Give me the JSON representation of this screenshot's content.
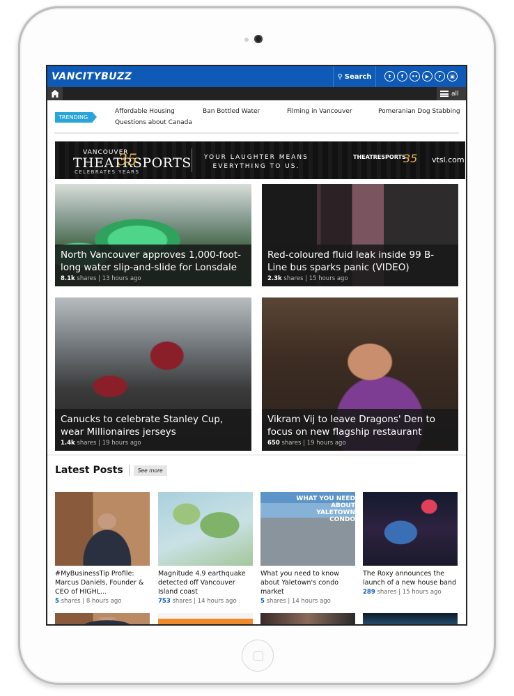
{
  "site": {
    "logo_text": "VANCITYBUZZ",
    "search_label": "Search",
    "social_icons": [
      "twitter-icon",
      "facebook-icon",
      "flickr-icon",
      "youtube-icon",
      "reddit-icon",
      "instagram-icon"
    ],
    "menu_label": "all",
    "brand_color": "#0e5ab6"
  },
  "trending": {
    "label": "TRENDING",
    "links": [
      "Affordable Housing",
      "Ban Bottled Water",
      "Filming in Vancouver",
      "Pomeranian Dog Stabbing",
      "Questions about Canada"
    ]
  },
  "ad": {
    "line1": "VANCOUVER",
    "line2": "THEATRSPORTS",
    "number": "35",
    "line3": "CELEBRATES YEARS",
    "tagline1": "YOUR LAUGHTER MEANS",
    "tagline2": "EVERYTHING TO US.",
    "logo_text": "THEATRESPORTS",
    "number2": "35",
    "url": "vtsl.com"
  },
  "featured": [
    {
      "title": "North Vancouver approves 1,000-foot-long water slip-and-slide for Lonsdale",
      "shares": "8.1k",
      "shares_label": "shares",
      "time": "13 hours ago"
    },
    {
      "title": "Red-coloured fluid leak inside 99 B-Line bus sparks panic (VIDEO)",
      "shares": "2.3k",
      "shares_label": "shares",
      "time": "15 hours ago"
    },
    {
      "title": "Canucks to celebrate Stanley Cup, wear Millionaires jerseys",
      "shares": "1.4k",
      "shares_label": "shares",
      "time": "19 hours ago"
    },
    {
      "title": "Vikram Vij to leave Dragons' Den to focus on new flagship restaurant",
      "shares": "650",
      "shares_label": "shares",
      "time": "19 hours ago"
    }
  ],
  "latest": {
    "heading": "Latest Posts",
    "see_more": "See more",
    "posts": [
      {
        "title": "#MyBusinessTip Profile: Marcus Daniels, Founder & CEO of HIGHL...",
        "shares": "5",
        "shares_label": "shares",
        "time": "8 hours ago"
      },
      {
        "title": "Magnitude 4.9 earthquake detected off Vancouver Island coast",
        "shares": "753",
        "shares_label": "shares",
        "time": "14 hours ago"
      },
      {
        "title": "What you need to know about Yaletown's condo market",
        "shares": "5",
        "shares_label": "shares",
        "time": "14 hours ago",
        "overlay": "WHAT YOU NEED ABOUT YALETOWN CONDO"
      },
      {
        "title": "The Roxy announces the launch of a new house band",
        "shares": "289",
        "shares_label": "shares",
        "time": "15 hours ago"
      }
    ]
  }
}
